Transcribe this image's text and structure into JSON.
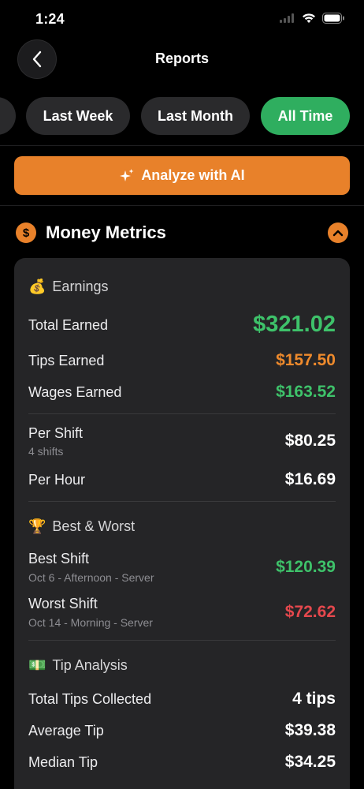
{
  "status": {
    "time": "1:24"
  },
  "nav": {
    "title": "Reports",
    "back_icon": "chevron-left-icon"
  },
  "filters": [
    {
      "label": "Last Week",
      "active": false
    },
    {
      "label": "Last Month",
      "active": false
    },
    {
      "label": "All Time",
      "active": true
    }
  ],
  "ai_button": {
    "label": "Analyze with AI",
    "icon": "sparkles-icon"
  },
  "section": {
    "title": "Money Metrics",
    "icon": "dollar-icon",
    "symbol": "$",
    "collapse_icon": "chevron-up-icon"
  },
  "earnings": {
    "header": "Earnings",
    "emoji": "💰",
    "total_label": "Total Earned",
    "total_value": "$321.02",
    "tips_label": "Tips Earned",
    "tips_value": "$157.50",
    "wages_label": "Wages Earned",
    "wages_value": "$163.52",
    "per_shift_label": "Per Shift",
    "per_shift_sub": "4 shifts",
    "per_shift_value": "$80.25",
    "per_hour_label": "Per Hour",
    "per_hour_value": "$16.69"
  },
  "best_worst": {
    "header": "Best & Worst",
    "emoji": "🏆",
    "best_label": "Best Shift",
    "best_sub": "Oct 6 - Afternoon - Server",
    "best_value": "$120.39",
    "worst_label": "Worst Shift",
    "worst_sub": "Oct 14 - Morning - Server",
    "worst_value": "$72.62"
  },
  "tips": {
    "header": "Tip Analysis",
    "emoji": "💵",
    "total_label": "Total Tips Collected",
    "total_value": "4 tips",
    "avg_label": "Average Tip",
    "avg_value": "$39.38",
    "median_label": "Median Tip",
    "median_value": "$34.25"
  },
  "colors": {
    "accent_orange": "#e8812a",
    "accent_green": "#2fae5f",
    "positive": "#3ec26a",
    "negative": "#e5484d"
  }
}
